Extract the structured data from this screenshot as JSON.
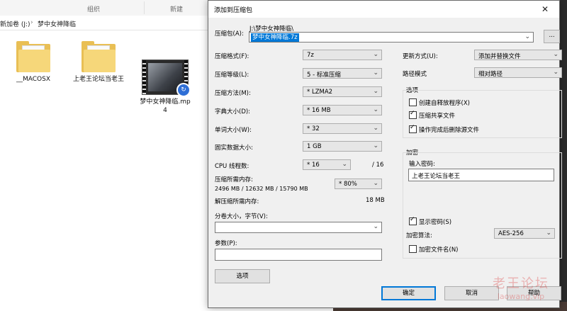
{
  "explorer": {
    "ribbon": {
      "group_label": "组织",
      "new_label": "新建"
    },
    "breadcrumb": {
      "drive": "新加卷 (J:)",
      "folder": "梦中女神降临"
    },
    "files": [
      {
        "name": "__MACOSX",
        "type": "folder"
      },
      {
        "name": "上老王论坛当老王",
        "type": "folder"
      },
      {
        "name": "梦中女神降临.mp4",
        "type": "video"
      }
    ]
  },
  "dialog": {
    "title": "添加到压缩包",
    "close_icon": "✕",
    "archive": {
      "label": "压缩包(A):",
      "path": "J:\\梦中女神降临\\",
      "filename": "梦中女神降临.7z",
      "browse_label": "..."
    },
    "format": {
      "label": "压缩格式(F):",
      "value": "7z"
    },
    "level": {
      "label": "压缩等级(L):",
      "value": "5 - 标准压缩"
    },
    "method": {
      "label": "压缩方法(M):",
      "value": "* LZMA2"
    },
    "dict": {
      "label": "字典大小(D):",
      "value": "* 16 MB"
    },
    "word": {
      "label": "单词大小(W):",
      "value": "* 32"
    },
    "solid": {
      "label": "固实数据大小:",
      "value": "1 GB"
    },
    "cpu": {
      "label": "CPU 线程数:",
      "value": "* 16",
      "max": "/ 16"
    },
    "memory": {
      "label": "压缩所需内存:",
      "value": "2496 MB / 12632 MB / 15790 MB",
      "percent": "* 80%"
    },
    "decomp_memory": {
      "label": "解压缩所需内存:",
      "value": "18 MB"
    },
    "split": {
      "label": "分卷大小，字节(V):",
      "value": ""
    },
    "params": {
      "label": "参数(P):",
      "value": ""
    },
    "options_button": "选项",
    "update_mode": {
      "label": "更新方式(U):",
      "value": "添加并替换文件"
    },
    "path_mode": {
      "label": "路径模式",
      "value": "相对路径"
    },
    "options_group": {
      "title": "选项",
      "items": [
        {
          "label": "创建自释放程序(X)",
          "checked": false
        },
        {
          "label": "压缩共享文件",
          "checked": true
        },
        {
          "label": "操作完成后删除源文件",
          "checked": true
        }
      ]
    },
    "encryption": {
      "title": "加密",
      "password_label": "输入密码:",
      "password_value": "上老王论坛当老王",
      "show_password": {
        "label": "显示密码(S)",
        "checked": true
      },
      "method_label": "加密算法:",
      "method_value": "AES-256",
      "encrypt_names": {
        "label": "加密文件名(N)",
        "checked": false
      }
    },
    "buttons": {
      "ok": "确定",
      "cancel": "取消",
      "help": "帮助"
    }
  },
  "watermark": {
    "line1": "老王论坛",
    "line2": "laowang.vip"
  }
}
